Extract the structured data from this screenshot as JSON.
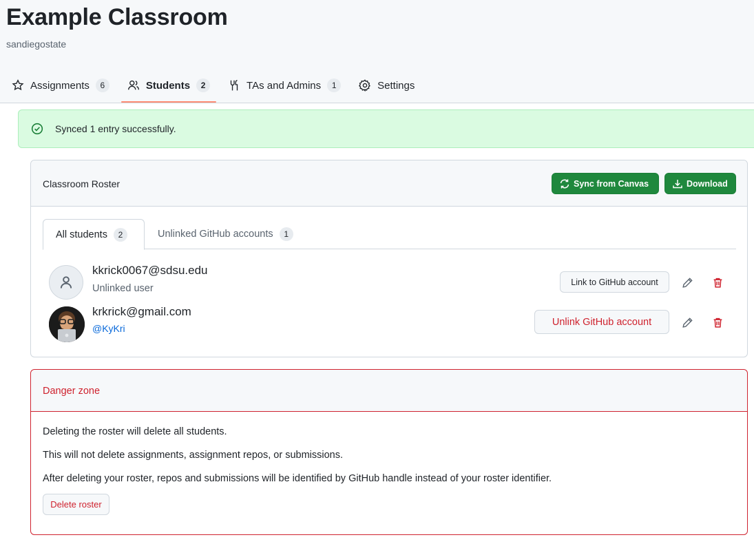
{
  "header": {
    "title": "Example Classroom",
    "org": "sandiegostate"
  },
  "tabs": [
    {
      "label": "Assignments",
      "count": "6",
      "icon": "star-icon"
    },
    {
      "label": "Students",
      "count": "2",
      "icon": "people-icon"
    },
    {
      "label": "TAs and Admins",
      "count": "1",
      "icon": "tools-icon"
    },
    {
      "label": "Settings",
      "icon": "gear-icon"
    }
  ],
  "flash": {
    "message": "Synced 1 entry successfully.",
    "icon": "check-circle-icon"
  },
  "roster": {
    "title": "Classroom Roster",
    "sync_label": "Sync from Canvas",
    "download_label": "Download",
    "subtabs": [
      {
        "label": "All students",
        "count": "2"
      },
      {
        "label": "Unlinked GitHub accounts",
        "count": "1"
      }
    ],
    "students": [
      {
        "email": "kkrick0067@sdsu.edu",
        "subtitle": "Unlinked user",
        "action": "Link to GitHub account",
        "avatar": "default-person-icon"
      },
      {
        "email": "krkrick@gmail.com",
        "subtitle": "@KyKri",
        "action": "Unlink GitHub account",
        "avatar": "user-photo"
      }
    ]
  },
  "danger_zone": {
    "title": "Danger zone",
    "lines": [
      "Deleting the roster will delete all students.",
      "This will not delete assignments, assignment repos, or submissions.",
      "After deleting your roster, repos and submissions will be identified by GitHub handle instead of your roster identifier."
    ],
    "delete_label": "Delete roster"
  },
  "colors": {
    "accent_green": "#1f883d",
    "danger_red": "#cf222e",
    "link_blue": "#0969da",
    "tab_underline": "#fd8c73",
    "flash_bg": "#dafbe1"
  }
}
